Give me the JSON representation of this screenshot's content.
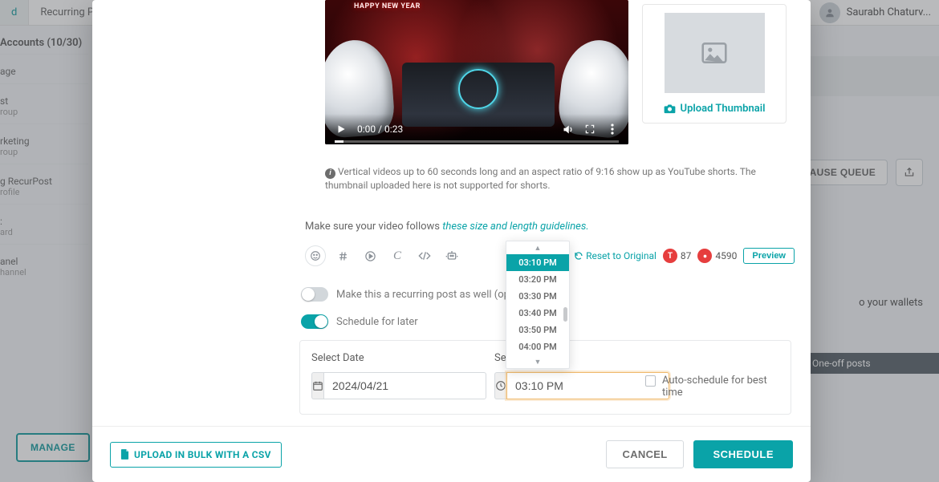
{
  "bg": {
    "tab1": "d",
    "tab2": "Recurring P",
    "user_name": "Saurabh Chaturv...",
    "accounts_label": "Accounts (10/30)",
    "side": [
      {
        "label": "age",
        "sub": ""
      },
      {
        "label": "st",
        "sub": "roup"
      },
      {
        "label": "rketing",
        "sub": "roup"
      },
      {
        "label": "g RecurPost",
        "sub": "rofile"
      },
      {
        "label": ":",
        "sub": "ard"
      },
      {
        "label": "anel",
        "sub": "hannel"
      }
    ],
    "pause_queue": "PAUSE QUEUE",
    "wallets": "o your wallets",
    "oneoff": "One-off posts",
    "manage": "MANAGE"
  },
  "video": {
    "overlay_title": "HAPPY\nNEW YEAR",
    "time": "0:00 / 0:23"
  },
  "thumbnail": {
    "upload_label": "Upload Thumbnail"
  },
  "notice": "Vertical videos up to 60 seconds long and an aspect ratio of 9:16 show up as YouTube shorts. The thumbnail uploaded here is not supported for shorts.",
  "guidelines_prefix": "Make sure your video follows ",
  "guidelines_link": "these size and length guidelines.",
  "toolbar": {
    "reset": "Reset to Original",
    "count1": "87",
    "count2": "4590",
    "preview": "Preview"
  },
  "toggles": {
    "recurring": "Make this a recurring post as well (option",
    "later": "Schedule for later"
  },
  "schedule": {
    "date_label": "Select Date",
    "time_label": "Select",
    "date_value": "2024/04/21",
    "time_value": "03:10 PM",
    "auto_label": "Auto-schedule for best time"
  },
  "time_options": [
    "03:10 PM",
    "03:20 PM",
    "03:30 PM",
    "03:40 PM",
    "03:50 PM",
    "04:00 PM"
  ],
  "footer": {
    "upload_csv": "UPLOAD IN BULK WITH A CSV",
    "cancel": "CANCEL",
    "schedule": "SCHEDULE"
  }
}
